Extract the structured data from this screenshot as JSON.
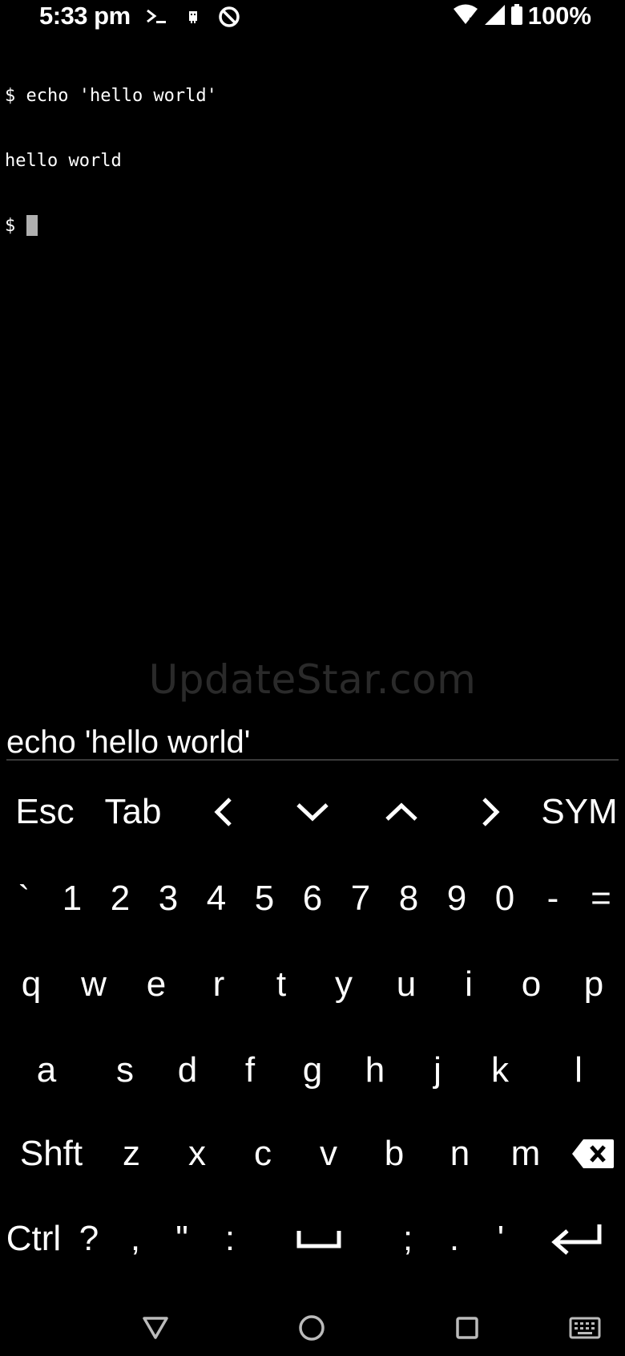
{
  "status_bar": {
    "time": "5:33 pm",
    "battery": "100%"
  },
  "terminal": {
    "lines": [
      "$ echo 'hello world'",
      "hello world",
      "$ "
    ]
  },
  "watermark": "UpdateStar.com",
  "input": {
    "value": "echo 'hello world'"
  },
  "extra_keys": {
    "esc": "Esc",
    "tab": "Tab",
    "sym": "SYM"
  },
  "keyboard": {
    "row_numbers": [
      "`",
      "1",
      "2",
      "3",
      "4",
      "5",
      "6",
      "7",
      "8",
      "9",
      "0",
      "-",
      "="
    ],
    "row_q": [
      "q",
      "w",
      "e",
      "r",
      "t",
      "y",
      "u",
      "i",
      "o",
      "p"
    ],
    "row_a": [
      "a",
      "s",
      "d",
      "f",
      "g",
      "h",
      "j",
      "k",
      "l"
    ],
    "row_z": {
      "shift": "Shft",
      "keys": [
        "z",
        "x",
        "c",
        "v",
        "b",
        "n",
        "m"
      ]
    },
    "row_bottom": {
      "ctrl": "Ctrl",
      "keys": [
        "?",
        ",",
        "\"",
        ":",
        ";",
        ".",
        "'"
      ]
    }
  },
  "icons": {
    "left_arrow": "chevron-left-icon",
    "down_arrow": "chevron-down-icon",
    "up_arrow": "chevron-up-icon",
    "right_arrow": "chevron-right-icon",
    "backspace": "backspace-icon",
    "space": "space-bar-icon",
    "enter": "enter-icon"
  }
}
